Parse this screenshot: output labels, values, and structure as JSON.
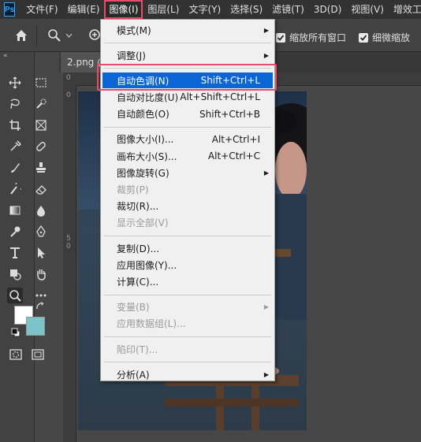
{
  "app": {
    "logo_text": "Ps"
  },
  "menubar": {
    "items": [
      "文件(F)",
      "编辑(E)",
      "图像(I)",
      "图层(L)",
      "文字(Y)",
      "选择(S)",
      "滤镜(T)",
      "3D(D)",
      "视图(V)",
      "增效工具"
    ],
    "active_index": 2
  },
  "options_bar": {
    "resize_windows_label": "缩放所有窗口",
    "scrubby_zoom_label": "细微缩放",
    "resize_windows_checked": true,
    "scrubby_zoom_checked": true
  },
  "tab": {
    "label": "2.png @"
  },
  "rulers": {
    "top_zero": "0",
    "left_numbers": [
      "0",
      "5",
      "0"
    ]
  },
  "colors": {
    "foreground": "#ffffff",
    "background": "#7cc4c8",
    "accent": "#0a66d4",
    "annotation": "#e94b6b"
  },
  "image_menu": {
    "items": [
      {
        "label": "模式(M)",
        "shortcut": "",
        "submenu": true,
        "disabled": false
      },
      {
        "separator": true
      },
      {
        "label": "调整(J)",
        "shortcut": "",
        "submenu": true,
        "disabled": false
      },
      {
        "separator": true
      },
      {
        "label": "自动色调(N)",
        "shortcut": "Shift+Ctrl+L",
        "submenu": false,
        "disabled": false,
        "highlighted": true
      },
      {
        "label": "自动对比度(U)",
        "shortcut": "Alt+Shift+Ctrl+L",
        "submenu": false,
        "disabled": false
      },
      {
        "label": "自动颜色(O)",
        "shortcut": "Shift+Ctrl+B",
        "submenu": false,
        "disabled": false
      },
      {
        "separator": true
      },
      {
        "label": "图像大小(I)...",
        "shortcut": "Alt+Ctrl+I",
        "submenu": false,
        "disabled": false
      },
      {
        "label": "画布大小(S)...",
        "shortcut": "Alt+Ctrl+C",
        "submenu": false,
        "disabled": false
      },
      {
        "label": "图像旋转(G)",
        "shortcut": "",
        "submenu": true,
        "disabled": false
      },
      {
        "label": "裁剪(P)",
        "shortcut": "",
        "submenu": false,
        "disabled": true
      },
      {
        "label": "裁切(R)...",
        "shortcut": "",
        "submenu": false,
        "disabled": false
      },
      {
        "label": "显示全部(V)",
        "shortcut": "",
        "submenu": false,
        "disabled": true
      },
      {
        "separator": true
      },
      {
        "label": "复制(D)...",
        "shortcut": "",
        "submenu": false,
        "disabled": false
      },
      {
        "label": "应用图像(Y)...",
        "shortcut": "",
        "submenu": false,
        "disabled": false
      },
      {
        "label": "计算(C)...",
        "shortcut": "",
        "submenu": false,
        "disabled": false
      },
      {
        "separator": true
      },
      {
        "label": "变量(B)",
        "shortcut": "",
        "submenu": true,
        "disabled": true
      },
      {
        "label": "应用数据组(L)...",
        "shortcut": "",
        "submenu": false,
        "disabled": true
      },
      {
        "separator": true
      },
      {
        "label": "陷印(T)...",
        "shortcut": "",
        "submenu": false,
        "disabled": true
      },
      {
        "separator": true
      },
      {
        "label": "分析(A)",
        "shortcut": "",
        "submenu": true,
        "disabled": false
      }
    ]
  },
  "tools": [
    "move-tool-icon",
    "marquee-tool-icon",
    "lasso-tool-icon",
    "quick-select-tool-icon",
    "crop-tool-icon",
    "frame-tool-icon",
    "eyedropper-tool-icon",
    "healing-brush-icon",
    "brush-tool-icon",
    "stamp-tool-icon",
    "history-brush-icon",
    "eraser-tool-icon",
    "gradient-tool-icon",
    "blur-tool-icon",
    "dodge-tool-icon",
    "pen-tool-icon",
    "type-tool-icon",
    "path-select-tool-icon",
    "shape-tool-icon",
    "hand-tool-icon",
    "zoom-tool-icon",
    "more-tools-icon"
  ]
}
